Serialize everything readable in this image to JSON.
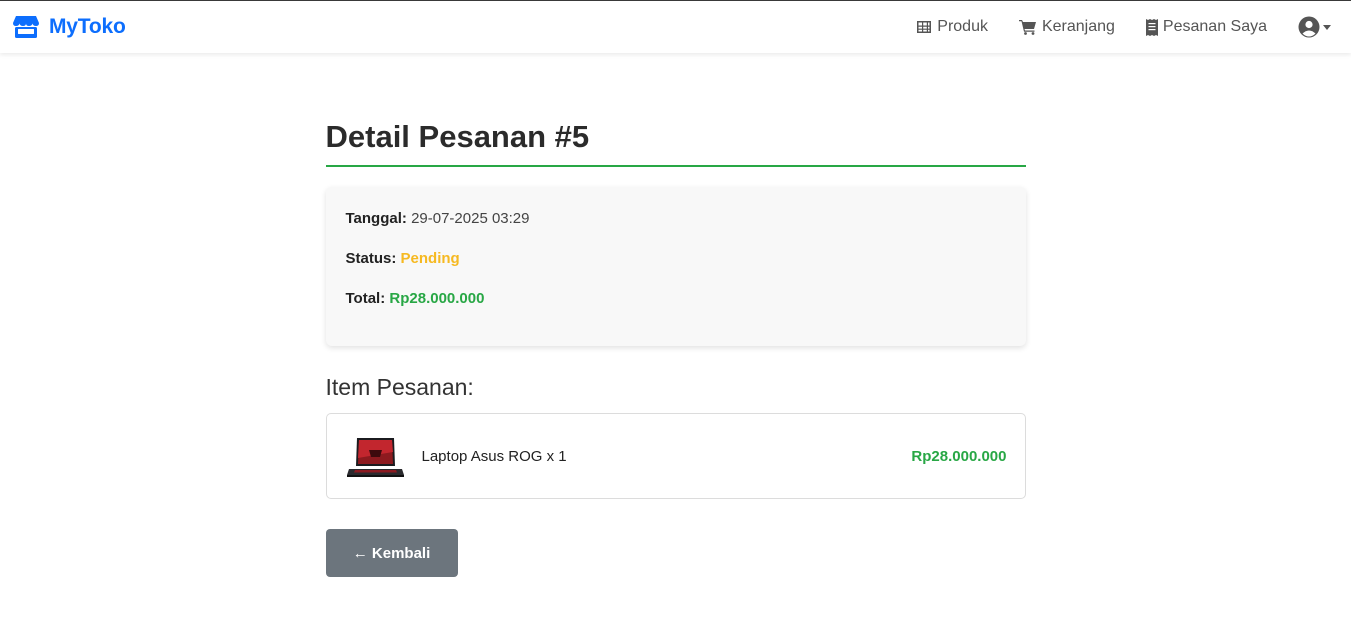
{
  "navbar": {
    "brand": "MyToko",
    "links": [
      {
        "label": "Produk",
        "icon": "grid-icon"
      },
      {
        "label": "Keranjang",
        "icon": "cart-icon"
      },
      {
        "label": "Pesanan Saya",
        "icon": "receipt-icon"
      }
    ],
    "user_icon": "user-circle-icon"
  },
  "order": {
    "title": "Detail Pesanan #5",
    "date_label": "Tanggal:",
    "date_value": "29-07-2025 03:29",
    "status_label": "Status:",
    "status_value": "Pending",
    "total_label": "Total:",
    "total_value": "Rp28.000.000"
  },
  "items_section": {
    "title": "Item Pesanan:",
    "items": [
      {
        "name": "Laptop Asus ROG x 1",
        "price": "Rp28.000.000",
        "image_icon": "laptop-thumbnail"
      }
    ]
  },
  "back_button": {
    "label": "← Kembali"
  },
  "colors": {
    "brand": "#0d6efd",
    "accent_green": "#28a745",
    "status_pending": "#f6b921",
    "button_gray": "#6c757d"
  }
}
